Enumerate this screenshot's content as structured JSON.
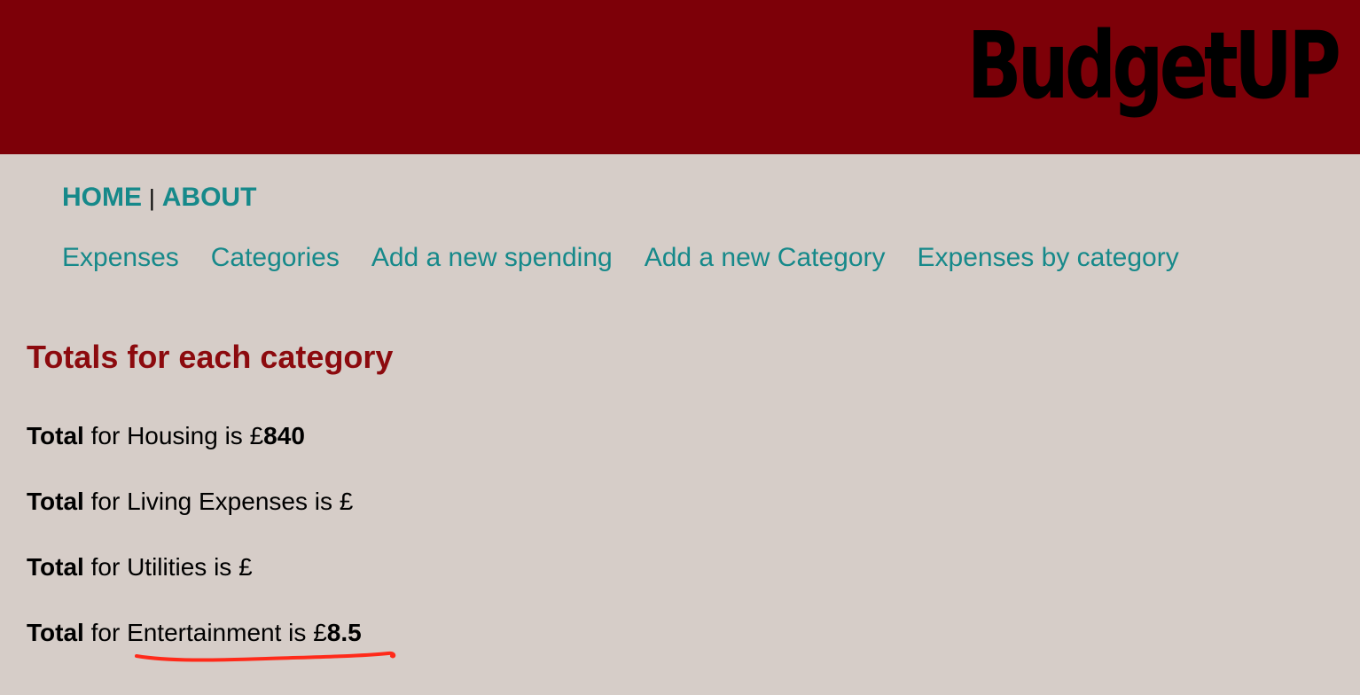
{
  "header": {
    "brand": "BudgetUP",
    "background_color": "#7d0008"
  },
  "topnav": {
    "home": "HOME",
    "separator": "|",
    "about": "ABOUT"
  },
  "subnav": {
    "items": [
      "Expenses",
      "Categories",
      "Add a new spending",
      "Add a new Category",
      "Expenses by category"
    ]
  },
  "main": {
    "heading": "Totals for each category",
    "totals": [
      {
        "total_label": "Total",
        "for_text": "for",
        "category": "Housing",
        "is_text": "is",
        "currency": "£",
        "amount": "840"
      },
      {
        "total_label": "Total",
        "for_text": "for",
        "category": "Living Expenses",
        "is_text": "is",
        "currency": "£",
        "amount": ""
      },
      {
        "total_label": "Total",
        "for_text": "for",
        "category": "Utilities",
        "is_text": "is",
        "currency": "£",
        "amount": ""
      },
      {
        "total_label": "Total",
        "for_text": "for",
        "category": "Entertainment",
        "is_text": "is",
        "currency": "£",
        "amount": "8.5"
      }
    ]
  },
  "colors": {
    "link": "#16898a",
    "heading": "#8c0a0e",
    "page_background": "#d6cdc8",
    "annotation": "#ff2a1a"
  }
}
